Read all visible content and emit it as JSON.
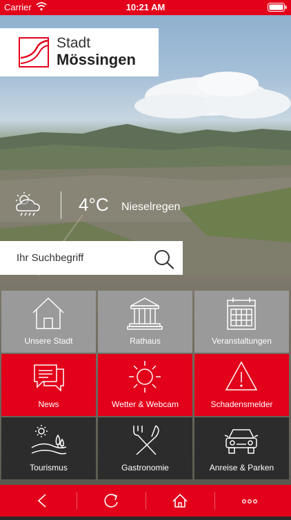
{
  "status_bar": {
    "carrier": "Carrier",
    "time": "10:21 AM"
  },
  "header": {
    "logo_line1": "Stadt",
    "logo_line2": "Mössingen"
  },
  "weather": {
    "icon": "cloud-drizzle-icon",
    "temperature": "4°C",
    "description": "Nieselregen"
  },
  "search": {
    "placeholder": "Ihr Suchbegriff",
    "icon": "search-icon"
  },
  "tiles": [
    {
      "label": "Unsere Stadt",
      "icon": "house-icon",
      "color": "#9a9a9a"
    },
    {
      "label": "Rathaus",
      "icon": "town-hall-icon",
      "color": "#9a9a9a"
    },
    {
      "label": "Veranstaltungen",
      "icon": "calendar-icon",
      "color": "#9a9a9a"
    },
    {
      "label": "News",
      "icon": "chat-bubbles-icon",
      "color": "#e2001a"
    },
    {
      "label": "Wetter & Webcam",
      "icon": "sun-icon",
      "color": "#e2001a"
    },
    {
      "label": "Schadensmelder",
      "icon": "warning-icon",
      "color": "#e2001a"
    },
    {
      "label": "Tourismus",
      "icon": "landscape-icon",
      "color": "#2c2c2c"
    },
    {
      "label": "Gastronomie",
      "icon": "fork-knife-icon",
      "color": "#2c2c2c"
    },
    {
      "label": "Anreise & Parken",
      "icon": "car-icon",
      "color": "#2c2c2c"
    }
  ],
  "bottom_bar": [
    {
      "icon": "back-icon"
    },
    {
      "icon": "refresh-icon"
    },
    {
      "icon": "home-icon"
    },
    {
      "icon": "more-icon"
    }
  ],
  "colors": {
    "brand_red": "#e2001a",
    "tile_gray": "#9a9a9a",
    "tile_dark": "#2c2c2c"
  }
}
